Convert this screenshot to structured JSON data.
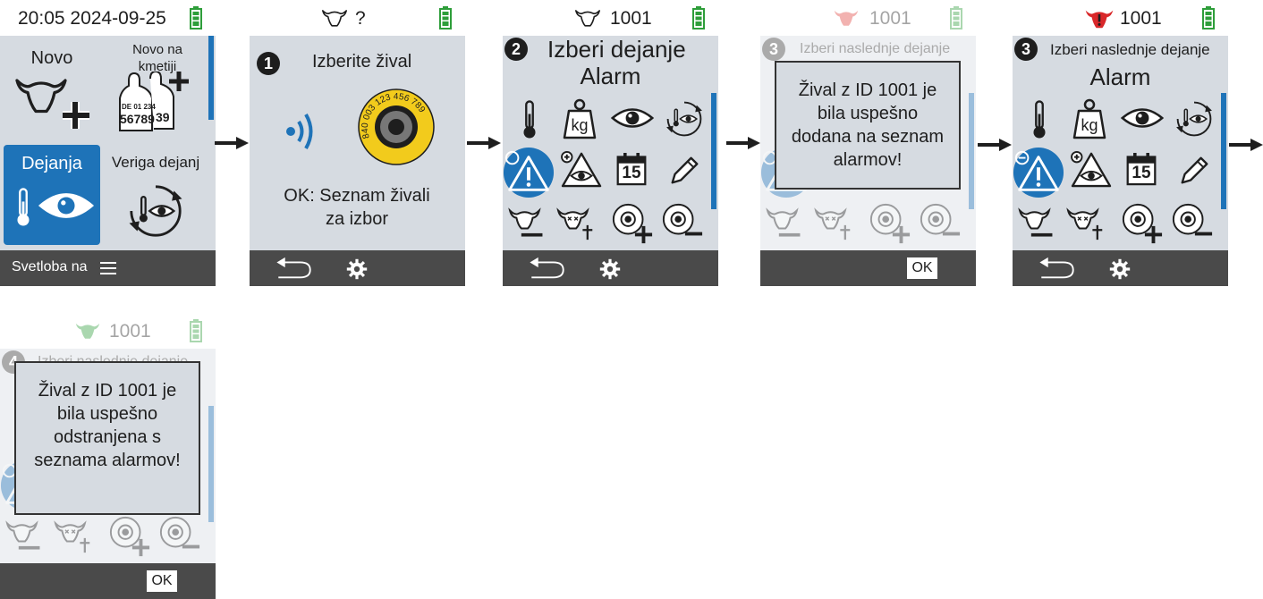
{
  "colors": {
    "panel": "#d6dbe1",
    "footer": "#4a4a4a",
    "accent": "#1e73b8",
    "battery": "#2e9e3a"
  },
  "screen1": {
    "status_time": "20:05 2024-09-25",
    "tile_new": "Novo",
    "tile_new_farm": "Novo na kmetiji",
    "tag_line1": "DE 01 234",
    "tag_line2": "56789",
    "tag_line3": "39",
    "tile_actions": "Dejanja",
    "tile_chain": "Veriga dejanj",
    "footer_label": "Svetloba na"
  },
  "screen2": {
    "status_id": "?",
    "step": "1",
    "title": "Izberite žival",
    "tag_text": "840 003 123 456 789",
    "ok_hint": "OK: Seznam živali za izbor"
  },
  "screen3": {
    "status_id": "1001",
    "step": "2",
    "title_line1": "Izberi dejanje",
    "title_line2": "Alarm",
    "kg_label": "kg",
    "cal_day": "15"
  },
  "screen4": {
    "status_id": "1001",
    "step": "3",
    "title": "Izberi naslednje dejanje",
    "dialog_text": "Žival z ID 1001 je bila uspešno dodana na seznam alarmov!",
    "ok_label": "OK"
  },
  "screen5": {
    "status_id": "1001",
    "step": "3",
    "title_line1": "Izberi naslednje dejanje",
    "title_line2": "Alarm",
    "kg_label": "kg",
    "cal_day": "15"
  },
  "screen6": {
    "status_id": "1001",
    "step": "4",
    "title": "Izberi naslednje dejanje",
    "dialog_text": "Žival z ID 1001 je bila uspešno odstranjena s seznama alarmov!",
    "ok_label": "OK"
  }
}
